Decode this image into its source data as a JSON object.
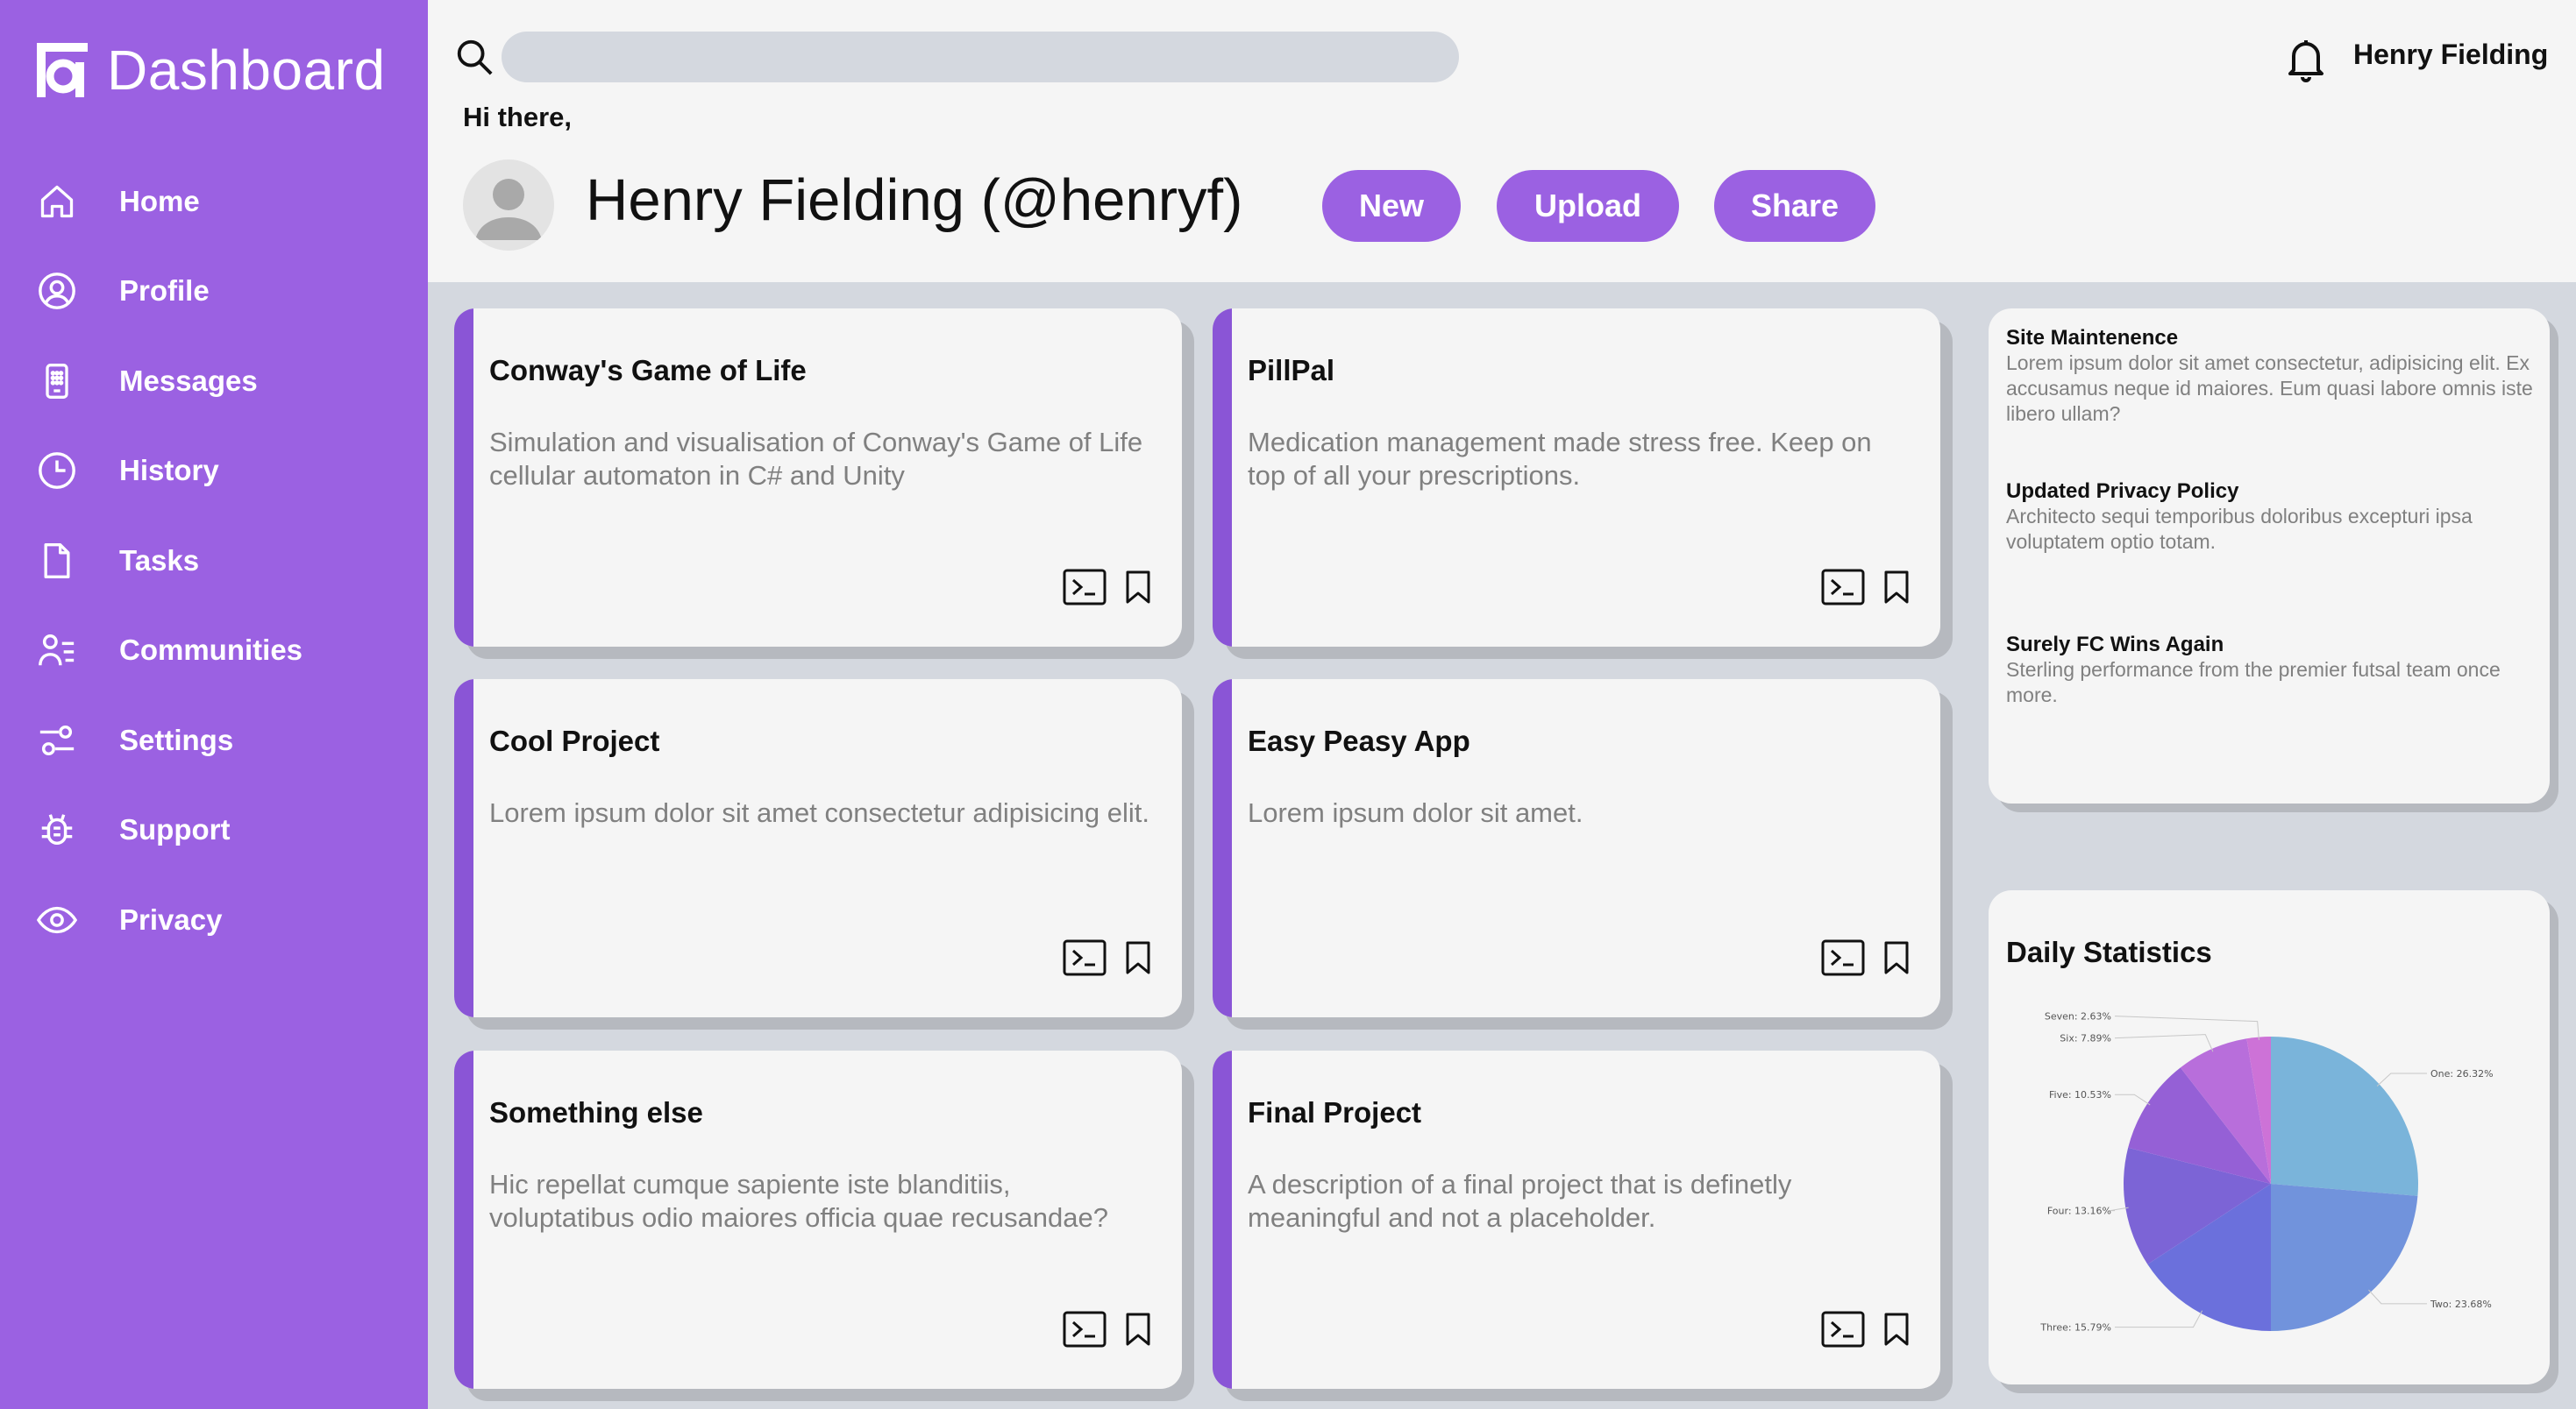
{
  "brand": {
    "title": "Dashboard",
    "icon": "dashboard-logo-icon"
  },
  "sidebar": {
    "items": [
      {
        "label": "Home",
        "icon": "home-icon"
      },
      {
        "label": "Profile",
        "icon": "user-circle-icon"
      },
      {
        "label": "Messages",
        "icon": "phone-icon"
      },
      {
        "label": "History",
        "icon": "clock-icon"
      },
      {
        "label": "Tasks",
        "icon": "document-icon"
      },
      {
        "label": "Communities",
        "icon": "users-list-icon"
      },
      {
        "label": "Settings",
        "icon": "sliders-icon"
      },
      {
        "label": "Support",
        "icon": "bug-icon"
      },
      {
        "label": "Privacy",
        "icon": "eye-icon"
      }
    ]
  },
  "header": {
    "search_placeholder": "",
    "user_name": "Henry Fielding",
    "greeting": "Hi there,",
    "profile_name": "Henry Fielding (@henryf)",
    "buttons": {
      "new": "New",
      "upload": "Upload",
      "share": "Share"
    }
  },
  "projects": [
    {
      "title": "Conway's Game of Life",
      "description": "Simulation and visualisation of Conway's Game of Life cellular automaton in C# and Unity"
    },
    {
      "title": "PillPal",
      "description": "Medication management made stress free. Keep on top of all your prescriptions."
    },
    {
      "title": "Cool Project",
      "description": "Lorem ipsum dolor sit amet consectetur adipisicing elit."
    },
    {
      "title": "Easy Peasy App",
      "description": "Lorem ipsum dolor sit amet."
    },
    {
      "title": "Something else",
      "description": "Hic repellat cumque sapiente iste blanditiis, voluptatibus odio maiores officia quae recusandae?"
    },
    {
      "title": "Final Project",
      "description": "A description of a final project that is definetly meaningful and not a placeholder."
    }
  ],
  "announcements": [
    {
      "title": "Site Maintenence",
      "body": "Lorem ipsum dolor sit amet consectetur, adipisicing elit. Ex accusamus neque id maiores. Eum quasi labore omnis iste libero ullam?"
    },
    {
      "title": "Updated Privacy Policy",
      "body": "Architecto sequi temporibus doloribus excepturi ipsa voluptatem optio totam."
    },
    {
      "title": "Surely FC Wins Again",
      "body": "Sterling performance from the premier futsal team once more."
    }
  ],
  "stats": {
    "title": "Daily Statistics"
  },
  "colors": {
    "accent": "#9b61e2",
    "card_stripe": "#8a55d6",
    "background": "#d4d8df",
    "surface": "#f5f5f5"
  },
  "chart_data": {
    "type": "pie",
    "title": "Daily Statistics",
    "labels": [
      "One",
      "Two",
      "Three",
      "Four",
      "Five",
      "Six",
      "Seven"
    ],
    "values": [
      26.32,
      23.68,
      15.79,
      13.16,
      10.53,
      7.89,
      2.63
    ],
    "value_labels": [
      "One: 26.32%",
      "Two: 23.68%",
      "Three: 15.79%",
      "Four: 13.16%",
      "Five: 10.53%",
      "Six: 7.89%",
      "Seven: 2.63%"
    ],
    "colors": [
      "#7ab4da",
      "#7193dc",
      "#6b70dc",
      "#7c64d6",
      "#9560d6",
      "#b86edb",
      "#cd72d7"
    ]
  }
}
